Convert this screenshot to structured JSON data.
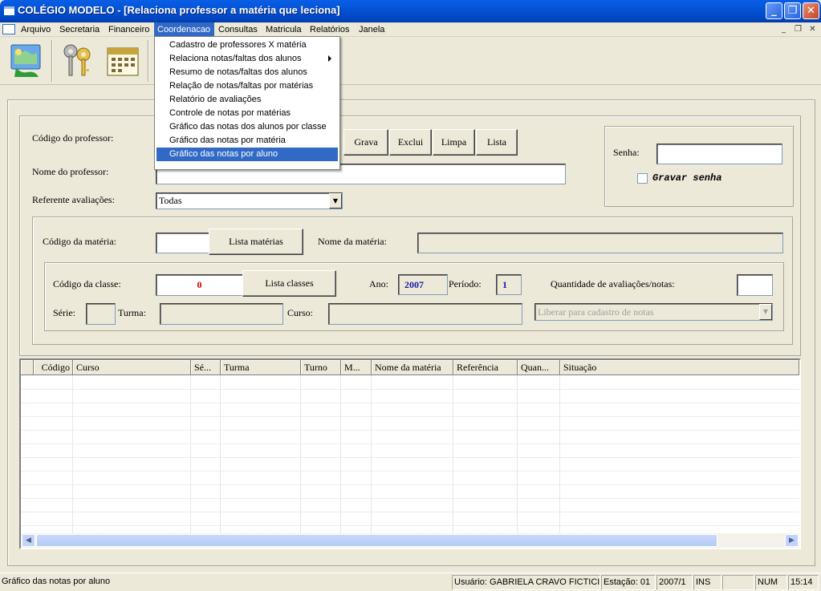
{
  "window": {
    "title": "COLÉGIO MODELO - [Relaciona professor a matéria que leciona]",
    "minimize_glyph": "_",
    "restore_glyph": "❐",
    "close_glyph": "✕"
  },
  "menu": {
    "items": [
      "Arquivo",
      "Secretaria",
      "Financeiro",
      "Coordenacao",
      "Consultas",
      "Matricula",
      "Relatórios",
      "Janela"
    ],
    "selected": "Coordenacao",
    "mdi_minimize": "_",
    "mdi_restore": "❐",
    "mdi_close": "✕"
  },
  "dropdown": {
    "items": [
      "Cadastro de professores X matéria",
      "Relaciona notas/faltas dos alunos",
      "Resumo de notas/faltas dos alunos",
      "Relação de notas/faltas por matérias",
      "Relatório de avaliações",
      "Controle de notas por matérias",
      "Gráfico das notas dos alunos por classe",
      "Gráfico das notas por matéria",
      "Gráfico das notas por aluno"
    ],
    "highlighted": "Gráfico das notas por aluno",
    "submenu_item": "Relaciona notas/faltas dos alunos"
  },
  "toolbar": {
    "icons": [
      "users-map-icon",
      "keys-icon",
      "calendar-icon"
    ]
  },
  "professor": {
    "codigo_label": "Código do professor:",
    "nome_label": "Nome do professor:",
    "referente_label": "Referente avaliações:",
    "referente_value": "Todas"
  },
  "actions": {
    "grava": "Grava",
    "exclui": "Exclui",
    "limpa": "Limpa",
    "lista": "Lista"
  },
  "senha": {
    "label": "Senha:",
    "checkbox_label": "Gravar senha"
  },
  "materia": {
    "codigo_label": "Código da matéria:",
    "lista_button": "Lista matérias",
    "nome_label": "Nome da matéria:"
  },
  "classe": {
    "codigo_label": "Código da classe:",
    "codigo_value": "0",
    "lista_button": "Lista classes",
    "ano_label": "Ano:",
    "ano_value": "2007",
    "periodo_label": "Período:",
    "periodo_value": "1",
    "quantidade_label": "Quantidade de avaliações/notas:",
    "serie_label": "Série:",
    "turma_label": "Turma:",
    "curso_label": "Curso:",
    "liberar_value": "Liberar para cadastro de notas"
  },
  "grid": {
    "columns": [
      "Código",
      "Curso",
      "Sé...",
      "Turma",
      "Turno",
      "M...",
      "Nome da matéria",
      "Referência",
      "Quan...",
      "Situação"
    ]
  },
  "status": {
    "message": "Gráfico das notas por aluno",
    "usuario": "Usuário: GABRIELA CRAVO FICTICIO",
    "estacao": "Estação: 01",
    "periodo": "2007/1",
    "ins": "INS",
    "num": "NUM",
    "time": "15:14"
  },
  "colors": {
    "titlebar": "#0353d6",
    "selection": "#316ac5",
    "codigo_classe": "#cc0000",
    "ano_periodo": "#1a1aa6"
  }
}
